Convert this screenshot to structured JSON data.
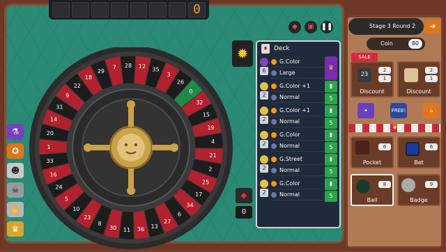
{
  "score": {
    "digits": [
      "",
      "",
      "",
      "",
      "",
      "",
      "",
      "0"
    ]
  },
  "top_icons": [
    "cards-icon",
    "dice-icon",
    "pause-icon"
  ],
  "wheel_numbers": [
    "32",
    "15",
    "19",
    "4",
    "21",
    "2",
    "25",
    "17",
    "34",
    "6",
    "27",
    "13",
    "36",
    "11",
    "30",
    "8",
    "23",
    "10",
    "5",
    "24",
    "16",
    "33",
    "1",
    "20",
    "14",
    "31",
    "9",
    "22",
    "18",
    "29",
    "7",
    "28",
    "12",
    "35",
    "3",
    "26",
    "0"
  ],
  "deck": {
    "title": "Deck",
    "cards": [
      {
        "level": "6",
        "name": "G.Color",
        "mod": "Large",
        "tag": "crown",
        "badge_count": ""
      },
      {
        "level": "2",
        "name": "G.Color +1",
        "mod": "Normal",
        "tag": "green",
        "badge_count": "5"
      },
      {
        "level": "2",
        "name": "G.Color +1",
        "mod": "Normal",
        "tag": "green",
        "badge_count": "5"
      },
      {
        "level": "2",
        "name": "G.Color",
        "mod": "Normal",
        "tag": "green",
        "badge_count": "5"
      },
      {
        "level": "2",
        "name": "G.Street",
        "mod": "Normal",
        "tag": "green",
        "badge_count": "5"
      },
      {
        "level": "2",
        "name": "G.Color",
        "mod": "Normal",
        "tag": "green",
        "badge_count": "5"
      }
    ]
  },
  "zero_card": {
    "value": "0"
  },
  "shop": {
    "stage_label": "Stage 3 Round 2",
    "coin_label": "Coin",
    "coin_value": "80",
    "sale_label": "SALE",
    "discount_slots": [
      {
        "label": "Discount",
        "price_a": "2",
        "price_b": "1",
        "count": "23"
      },
      {
        "label": "Discount",
        "price_a": "2",
        "price_b": "1"
      }
    ],
    "mid_icons": [
      "bonus-icon",
      "free-icon",
      "house-icon"
    ],
    "free_label": "FREE!",
    "slots": [
      {
        "label": "Pocket",
        "price": "6"
      },
      {
        "label": "Bet",
        "price": "6"
      },
      {
        "label": "Ball",
        "price": "8"
      },
      {
        "label": "Badge",
        "price": "9"
      }
    ],
    "colors": {
      "accent": "#e0751a",
      "sale": "#d8283a",
      "green": "#2aa54a",
      "purple": "#7a2bb0"
    }
  }
}
